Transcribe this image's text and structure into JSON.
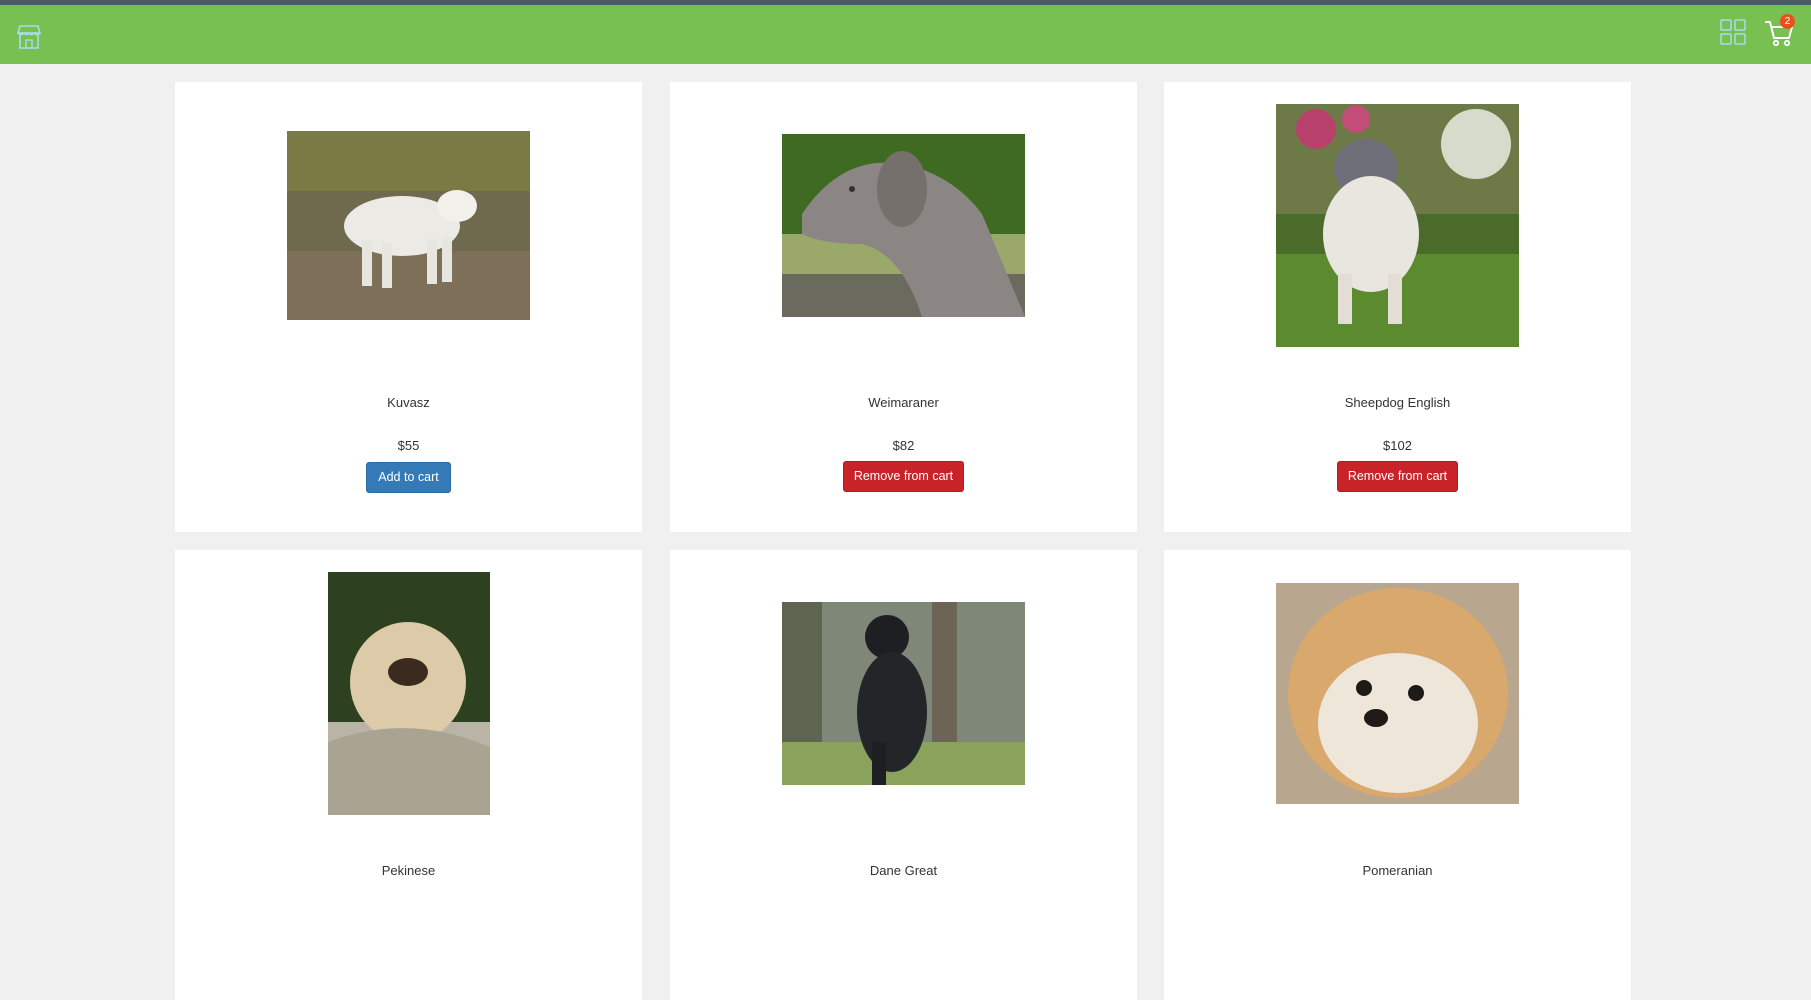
{
  "colors": {
    "navbar": "#78c052",
    "topstrip": "#4b5a67",
    "add_button": "#337ab7",
    "remove_button": "#c9232a",
    "badge": "#e8501d"
  },
  "navbar": {
    "logo_icon": "store-icon",
    "grid_icon": "grid-icon",
    "cart_icon": "cart-icon",
    "cart_count": "2"
  },
  "products": [
    {
      "name": "Kuvasz",
      "price": "$55",
      "button": "Add to cart",
      "in_cart": false,
      "image": "kuvasz-photo"
    },
    {
      "name": "Weimaraner",
      "price": "$82",
      "button": "Remove from cart",
      "in_cart": true,
      "image": "weimaraner-photo"
    },
    {
      "name": "Sheepdog English",
      "price": "$102",
      "button": "Remove from cart",
      "in_cart": true,
      "image": "sheepdog-english-photo"
    },
    {
      "name": "Pekinese",
      "image": "pekinese-photo"
    },
    {
      "name": "Dane Great",
      "image": "dane-great-photo"
    },
    {
      "name": "Pomeranian",
      "image": "pomeranian-photo"
    }
  ]
}
